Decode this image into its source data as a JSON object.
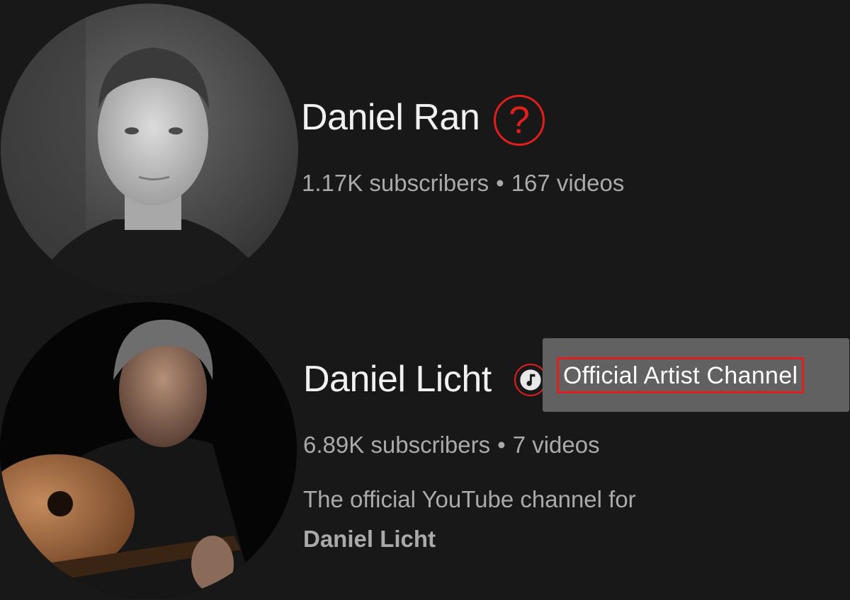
{
  "channels": [
    {
      "name": "Daniel Ran",
      "badge_symbol": "?",
      "subscribers": "1.17K subscribers",
      "separator": "•",
      "videos": "167 videos"
    },
    {
      "name": "Daniel Licht",
      "badge_icon": "music-note-icon",
      "subscribers": "6.89K subscribers",
      "separator": "•",
      "videos": "7 videos",
      "description_line1": "The official YouTube channel for",
      "description_line2": "Daniel Licht"
    }
  ],
  "tooltip": {
    "text": "Official Artist Channel"
  },
  "colors": {
    "background": "#181818",
    "highlight_red": "#e01e1e",
    "tooltip_bg": "#616161",
    "secondary_text": "#aaaaaa"
  }
}
